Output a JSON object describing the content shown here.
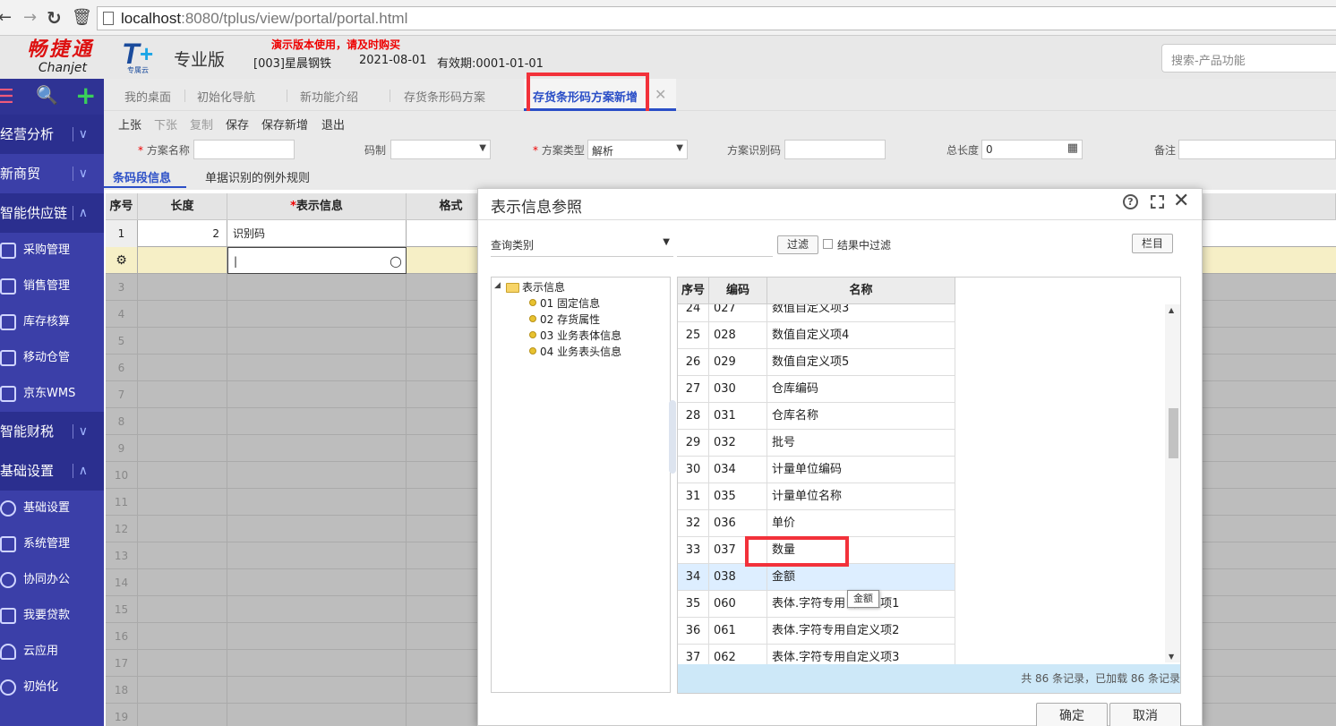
{
  "browser": {
    "url_host": "localhost",
    "url_rest": ":8080/tplus/view/portal/portal.html"
  },
  "header": {
    "brand_cn": "畅捷通",
    "brand_en": "Chanjet",
    "product_sub": "专属云",
    "edition": "专业版",
    "demo_notice": "演示版本使用，请及时购买",
    "company": "[003]星晨钢铁",
    "date": "2021-08-01",
    "validity": "有效期:0001-01-01",
    "search_placeholder": "搜索-产品功能"
  },
  "sidebar": {
    "sections": [
      {
        "label": "经营分析",
        "expanded": false
      },
      {
        "label": "新商贸",
        "expanded": false
      },
      {
        "label": "智能供应链",
        "expanded": true
      },
      {
        "label": "智能财税",
        "expanded": false
      },
      {
        "label": "基础设置",
        "expanded": true
      }
    ],
    "supply_items": [
      "采购管理",
      "销售管理",
      "库存核算",
      "移动仓管",
      "京东WMS"
    ],
    "base_items": [
      "基础设置",
      "系统管理",
      "协同办公",
      "我要贷款",
      "云应用",
      "初始化"
    ]
  },
  "tabs": [
    "我的桌面",
    "初始化导航",
    "新功能介绍",
    "存货条形码方案",
    "存货条形码方案新增"
  ],
  "toolbar": [
    "上张",
    "下张",
    "复制",
    "保存",
    "保存新增",
    "退出"
  ],
  "form": {
    "scheme_name_label": "方案名称",
    "code_label": "码制",
    "scheme_type_label": "方案类型",
    "scheme_type_value": "解析",
    "scheme_id_label": "方案识别码",
    "total_length_label": "总长度",
    "total_length_value": "0",
    "remark_label": "备注"
  },
  "subtabs": [
    "条码段信息",
    "单据识别的例外规则"
  ],
  "grid": {
    "headers": [
      "序号",
      "长度",
      "表示信息",
      "格式"
    ],
    "row1": {
      "no": "1",
      "length": "2",
      "info": "识别码"
    },
    "row_numbers": [
      "3",
      "4",
      "5",
      "6",
      "7",
      "8",
      "9",
      "10",
      "11",
      "12",
      "13",
      "14",
      "15",
      "16",
      "17",
      "18",
      "19"
    ]
  },
  "modal": {
    "title": "表示信息参照",
    "query_category": "查询类别",
    "filter_btn": "过滤",
    "filter_in_result": "结果中过滤",
    "column_btn": "栏目",
    "tree_root": "表示信息",
    "tree_items": [
      "01 固定信息",
      "02 存货属性",
      "03 业务表体信息",
      "04 业务表头信息"
    ],
    "table_headers": [
      "序号",
      "编码",
      "名称"
    ],
    "rows": [
      {
        "no": "24",
        "code": "027",
        "name": "数值自定义项3"
      },
      {
        "no": "25",
        "code": "028",
        "name": "数值自定义项4"
      },
      {
        "no": "26",
        "code": "029",
        "name": "数值自定义项5"
      },
      {
        "no": "27",
        "code": "030",
        "name": "仓库编码"
      },
      {
        "no": "28",
        "code": "031",
        "name": "仓库名称"
      },
      {
        "no": "29",
        "code": "032",
        "name": "批号"
      },
      {
        "no": "30",
        "code": "034",
        "name": "计量单位编码"
      },
      {
        "no": "31",
        "code": "035",
        "name": "计量单位名称"
      },
      {
        "no": "32",
        "code": "036",
        "name": "单价"
      },
      {
        "no": "33",
        "code": "037",
        "name": "数量"
      },
      {
        "no": "34",
        "code": "038",
        "name": "金额"
      },
      {
        "no": "35",
        "code": "060",
        "name": "表体.字符专用自定义项1"
      },
      {
        "no": "36",
        "code": "061",
        "name": "表体.字符专用自定义项2"
      },
      {
        "no": "37",
        "code": "062",
        "name": "表体.字符专用自定义项3"
      }
    ],
    "footer": "共 86 条记录，已加载 86 条记录",
    "tooltip": "金额",
    "ok": "确定",
    "cancel": "取消"
  },
  "colors": {
    "sidebar": "#3b3fa8",
    "accent": "#2b4fc7",
    "highlight_box": "#f2313a",
    "demo_text": "#e00000"
  }
}
